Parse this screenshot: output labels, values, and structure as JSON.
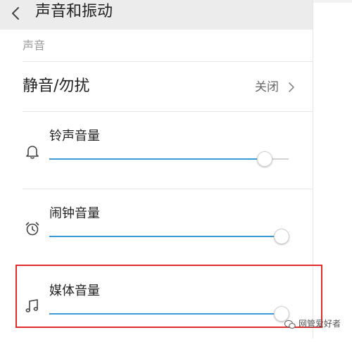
{
  "header": {
    "title": "声音和振动",
    "back_icon": "chevron-left-icon"
  },
  "section": {
    "label": "声音"
  },
  "dnd": {
    "label": "静音/勿扰",
    "value": "关闭",
    "chevron_icon": "chevron-right-icon"
  },
  "volumes": [
    {
      "id": "ringtone",
      "label": "铃声音量",
      "icon": "bell-icon",
      "level": 0.9
    },
    {
      "id": "alarm",
      "label": "闹钟音量",
      "icon": "alarm-clock-icon",
      "level": 0.97
    },
    {
      "id": "media",
      "label": "媒体音量",
      "icon": "music-note-icon",
      "level": 0.97
    }
  ],
  "colors": {
    "accent": "#3a9bd9",
    "highlight": "#e02b2b",
    "header_bg": "#ececec"
  },
  "watermark": {
    "text": "网管爱好者"
  }
}
